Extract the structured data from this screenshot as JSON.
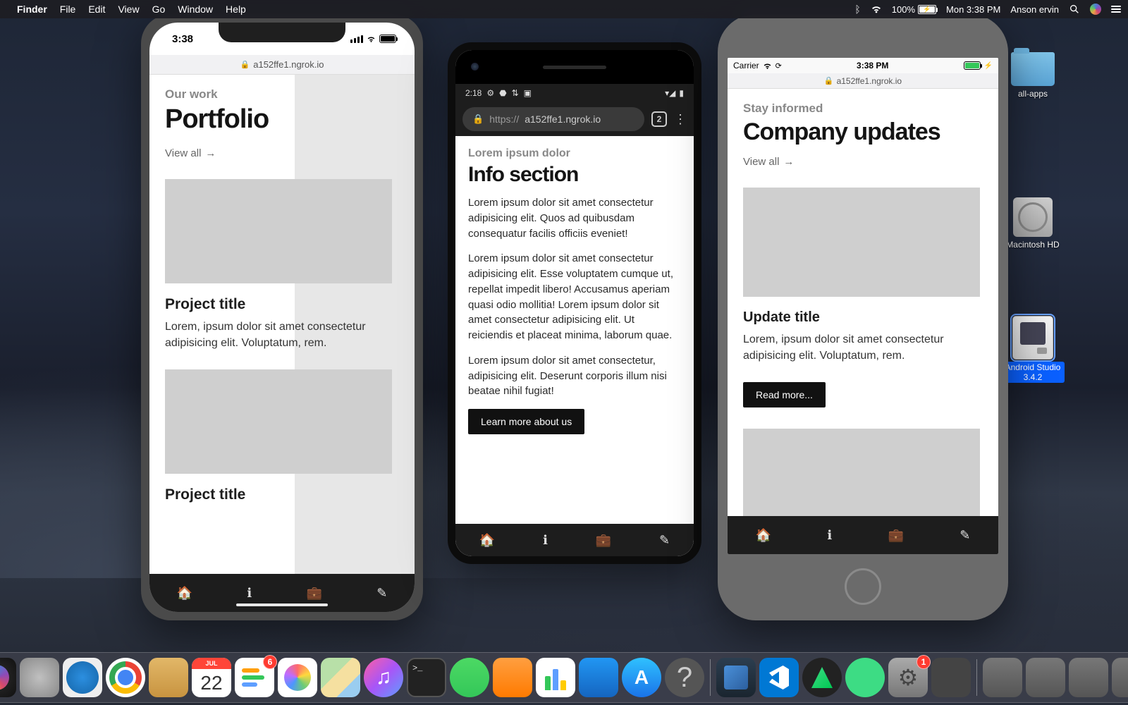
{
  "menubar": {
    "app": "Finder",
    "items": [
      "File",
      "Edit",
      "View",
      "Go",
      "Window",
      "Help"
    ],
    "battery_pct": "100%",
    "clock": "Mon 3:38 PM",
    "user": "Anson ervin"
  },
  "desktop": {
    "all_apps": "all-apps",
    "mac_hd": "Macintosh HD",
    "android_studio": "Android Studio 3.4.2"
  },
  "iphonex": {
    "time": "3:38",
    "url": "a152ffe1.ngrok.io",
    "eyebrow": "Our work",
    "title": "Portfolio",
    "viewall": "View all",
    "card1_title": "Project title",
    "card1_text": "Lorem, ipsum dolor sit amet consectetur adipisicing elit. Voluptatum, rem.",
    "card2_title": "Project title"
  },
  "android": {
    "time": "2:18",
    "url_prefix": "https://",
    "url_host": "a152ffe1.ngrok.io",
    "tab_count": "2",
    "eyebrow": "Lorem ipsum dolor",
    "title": "Info section",
    "p1": "Lorem ipsum dolor sit amet consectetur adipisicing elit. Quos ad quibusdam consequatur facilis officiis eveniet!",
    "p2": "Lorem ipsum dolor sit amet consectetur adipisicing elit. Esse voluptatem cumque ut, repellat impedit libero! Accusamus aperiam quasi odio mollitia! Lorem ipsum dolor sit amet consectetur adipisicing elit. Ut reiciendis et placeat minima, laborum quae.",
    "p3": "Lorem ipsum dolor sit amet consectetur, adipisicing elit. Deserunt corporis illum nisi beatae nihil fugiat!",
    "btn": "Learn more about us"
  },
  "iphone8": {
    "carrier": "Carrier",
    "time": "3:38 PM",
    "url": "a152ffe1.ngrok.io",
    "eyebrow": "Stay informed",
    "title": "Company updates",
    "viewall": "View all",
    "card_title": "Update title",
    "card_text": "Lorem, ipsum dolor sit amet consectetur adipisicing elit. Voluptatum, rem.",
    "btn": "Read more..."
  },
  "dock": {
    "cal_month": "JUL",
    "cal_day": "22",
    "reminders_badge": "6",
    "prefs_badge": "1",
    "help": "?"
  }
}
